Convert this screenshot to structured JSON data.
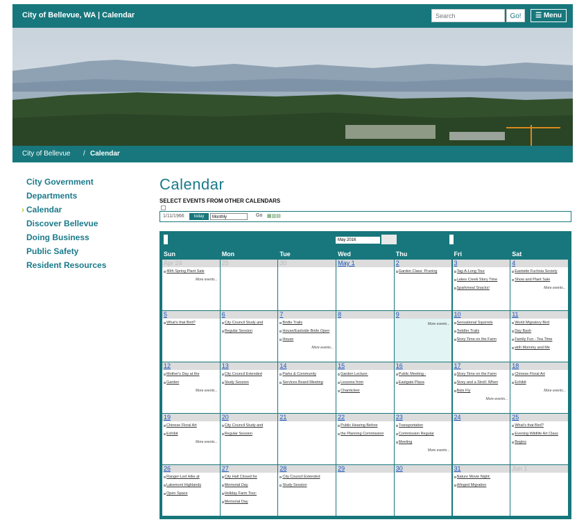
{
  "header": {
    "site_title": "City of Bellevue, WA  |  Calendar",
    "search_placeholder": "Search",
    "go_label": "Go!",
    "menu_label": "Menu"
  },
  "breadcrumb": {
    "home": "City of Bellevue",
    "separator": "/",
    "current": "Calendar"
  },
  "sidebar": {
    "items": [
      {
        "label": "City Government",
        "active": false
      },
      {
        "label": "Departments",
        "active": false
      },
      {
        "label": "Calendar",
        "active": true
      },
      {
        "label": "Discover Bellevue",
        "active": false
      },
      {
        "label": "Doing Business",
        "active": false
      },
      {
        "label": "Public Safety",
        "active": false
      },
      {
        "label": "Resident Resources",
        "active": false
      }
    ]
  },
  "main": {
    "title": "Calendar",
    "select_heading": "SELECT EVENTS FROM OTHER CALENDARS"
  },
  "toolbar": {
    "date": "1/11/1966",
    "today_label": "today",
    "view_value": "Monthly",
    "go_label": "Go"
  },
  "calendar": {
    "month_value": "May 2016",
    "weekdays": [
      "Sun",
      "Mon",
      "Tue",
      "Wed",
      "Thu",
      "Fri",
      "Sat"
    ],
    "more_label": "More events...",
    "weeks": [
      [
        {
          "day": "Apr 24",
          "other": true,
          "events": [
            "40th Spring Plant Sale"
          ],
          "more": true
        },
        {
          "day": "25",
          "other": true,
          "events": [],
          "more": false
        },
        {
          "day": "30",
          "other": true,
          "events": [],
          "more": false
        },
        {
          "day": "May 1",
          "other": false,
          "events": [],
          "more": false
        },
        {
          "day": "2",
          "other": false,
          "events": [
            "Garden Class: Pruning"
          ],
          "more": false
        },
        {
          "day": "3",
          "other": false,
          "events": [
            "Tag-A-Long Tour",
            "Lakes Creek Story Time",
            "Sparkmeal Snacks!"
          ],
          "more": false
        },
        {
          "day": "4",
          "other": false,
          "events": [
            "Eastside Fuchsia Society",
            "Show and Plant Sale"
          ],
          "more": true
        }
      ],
      [
        {
          "day": "5",
          "other": false,
          "events": [
            "What's that Bird?"
          ],
          "more": false
        },
        {
          "day": "6",
          "other": false,
          "events": [
            "City Council Study and",
            "Regular Session"
          ],
          "more": false
        },
        {
          "day": "7",
          "other": false,
          "events": [
            "Bridle Trails",
            "House/Eastside Bride Open",
            "House"
          ],
          "more": true
        },
        {
          "day": "8",
          "other": false,
          "events": [],
          "more": false
        },
        {
          "day": "9",
          "other": false,
          "events": [],
          "more": true,
          "highlight": true
        },
        {
          "day": "10",
          "other": false,
          "events": [
            "Sensational Squirrels",
            "Toddler Trails",
            "Story Time on the Farm"
          ],
          "more": false
        },
        {
          "day": "11",
          "other": false,
          "events": [
            "World Migratory Bird",
            "Day Bash",
            "Family Fun - Tea Time",
            "with Mommy and Me"
          ],
          "more": false
        }
      ],
      [
        {
          "day": "12",
          "other": false,
          "events": [
            "Mother's Day at the",
            "Garden"
          ],
          "more": true
        },
        {
          "day": "13",
          "other": false,
          "events": [
            "City Council Extended",
            "Study Session"
          ],
          "more": false
        },
        {
          "day": "14",
          "other": false,
          "events": [
            "Parks & Community",
            "Services Board Meeting"
          ],
          "more": false
        },
        {
          "day": "15",
          "other": false,
          "events": [
            "Garden Lecture:",
            "Lessons from",
            "Chanticleer"
          ],
          "more": false
        },
        {
          "day": "16",
          "other": false,
          "events": [
            "Public Meeting -",
            "Eastgate Plaza"
          ],
          "more": false
        },
        {
          "day": "17",
          "other": false,
          "events": [
            "Story Time on the Farm",
            "Story and a Stroll: When",
            "Bats Fly"
          ],
          "more": true
        },
        {
          "day": "18",
          "other": false,
          "events": [
            "Chinese Floral Art",
            "Exhibit"
          ],
          "more": true
        }
      ],
      [
        {
          "day": "19",
          "other": false,
          "events": [
            "Chinese Floral Art",
            "Exhibit"
          ],
          "more": true
        },
        {
          "day": "20",
          "other": false,
          "events": [
            "City Council Study and",
            "Regular Session"
          ],
          "more": false
        },
        {
          "day": "21",
          "other": false,
          "events": [],
          "more": false
        },
        {
          "day": "22",
          "other": false,
          "events": [
            "Public Hearing Before",
            "the Planning Commission"
          ],
          "more": false
        },
        {
          "day": "23",
          "other": false,
          "events": [
            "Transportation",
            "Commission Regular",
            "Meeting"
          ],
          "more": true
        },
        {
          "day": "24",
          "other": false,
          "events": [],
          "more": false
        },
        {
          "day": "25",
          "other": false,
          "events": [
            "What's that Bird?",
            "Evening Wildlife Art Class",
            "Begins"
          ],
          "more": false
        }
      ],
      [
        {
          "day": "26",
          "other": false,
          "events": [
            "Ranger-Led Hike at",
            "Lakemont Highlands",
            "Open Space"
          ],
          "more": false
        },
        {
          "day": "27",
          "other": false,
          "events": [
            "City Hall Closed for",
            "Memorial Day",
            "Holiday Farm Tour:",
            "Memorial Day"
          ],
          "more": false
        },
        {
          "day": "28",
          "other": false,
          "events": [
            "City Council Extended",
            "Study Session"
          ],
          "more": false
        },
        {
          "day": "29",
          "other": false,
          "events": [],
          "more": false
        },
        {
          "day": "30",
          "other": false,
          "events": [],
          "more": false
        },
        {
          "day": "31",
          "other": false,
          "events": [
            "Nature Movie Night:",
            "Winged Migration"
          ],
          "more": false
        },
        {
          "day": "Jun 1",
          "other": true,
          "events": [],
          "more": false
        }
      ]
    ]
  }
}
